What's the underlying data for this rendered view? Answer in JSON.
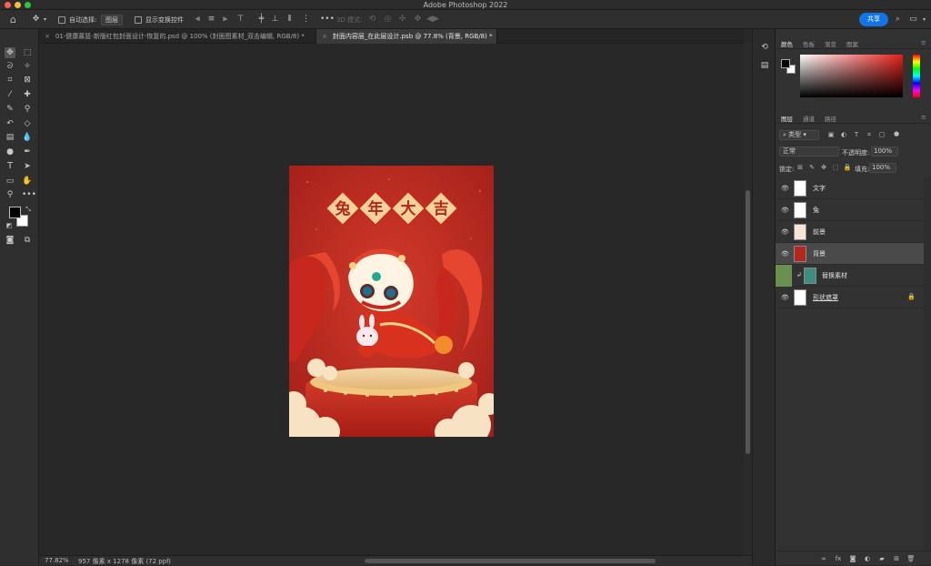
{
  "app": {
    "title": "Adobe Photoshop 2022"
  },
  "options_bar": {
    "auto_select_label": "自动选择:",
    "auto_select_value": "图层",
    "show_transform_label": "显示变换控件",
    "mode_3d_label": "3D 模式:",
    "share_label": "共享"
  },
  "tabs": [
    {
      "label": "01-健康慕篮-新版红包封面设计-恢复的.psd @ 100% (封面图素材_双击编辑, RGB/8) *",
      "active": false
    },
    {
      "label": "封面内容层_在此层设计.psb @ 77.8% (背景, RGB/8) *",
      "active": true
    }
  ],
  "artwork": {
    "headline": [
      "兔",
      "年",
      "大",
      "吉"
    ]
  },
  "status": {
    "zoom": "77.82%",
    "doc_info": "957 像素 x 1278 像素 (72 ppi)"
  },
  "color_panel": {
    "tabs": [
      "颜色",
      "色板",
      "渐变",
      "图案"
    ],
    "foreground": "#000000",
    "background": "#ffffff"
  },
  "layers_panel": {
    "tabs": [
      "图层",
      "通道",
      "路径"
    ],
    "filter_label": "类型",
    "blend_mode": "正常",
    "opacity_label": "不透明度:",
    "opacity_value": "100%",
    "lock_label": "锁定:",
    "fill_label": "填充:",
    "fill_value": "100%",
    "layers": [
      {
        "name": "文字",
        "selected": false
      },
      {
        "name": "兔",
        "selected": false
      },
      {
        "name": "前景",
        "selected": false
      },
      {
        "name": "背景",
        "selected": true
      },
      {
        "name": "替换素材",
        "selected": false
      },
      {
        "name": "形状遮罩",
        "selected": false
      }
    ]
  },
  "colors": {
    "accent": "#1473e6",
    "artwork_red": "#b5261c",
    "clip_indicator": "#6b8f4e"
  }
}
